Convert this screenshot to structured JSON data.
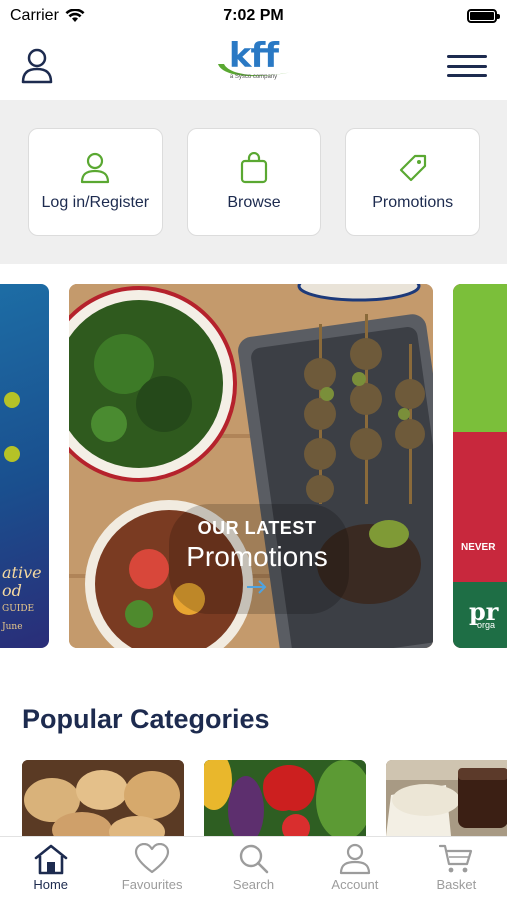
{
  "status_bar": {
    "carrier": "Carrier",
    "time": "7:02 PM"
  },
  "header": {
    "logo_text": "kff",
    "logo_subtitle": "a Sysco company",
    "account_icon": "user-icon",
    "menu_icon": "hamburger-menu-icon"
  },
  "quick_actions": [
    {
      "label": "Log in/Register",
      "icon": "user-icon"
    },
    {
      "label": "Browse",
      "icon": "shopping-bag-icon"
    },
    {
      "label": "Promotions",
      "icon": "tag-icon"
    }
  ],
  "carousel": {
    "left_slide_caption": "ative",
    "left_slide_caption_2": "od",
    "left_slide_guide": "GUIDE",
    "left_slide_month": "June",
    "main_slide_heading": "OUR LATEST",
    "main_slide_title": "Promotions",
    "right_slide_text": "NEVER",
    "right_slide_brand": "pr",
    "right_slide_brand_sub": "orga"
  },
  "section_title": "Popular Categories",
  "bottom_nav": [
    {
      "label": "Home",
      "icon": "home-icon",
      "active": true
    },
    {
      "label": "Favourites",
      "icon": "heart-icon",
      "active": false
    },
    {
      "label": "Search",
      "icon": "search-icon",
      "active": false
    },
    {
      "label": "Account",
      "icon": "user-icon",
      "active": false
    },
    {
      "label": "Basket",
      "icon": "basket-icon",
      "active": false
    }
  ],
  "colors": {
    "primary_navy": "#1d2b4f",
    "accent_green": "#5aa832",
    "logo_blue": "#2a79c4",
    "nav_inactive": "#9c9c9c"
  }
}
